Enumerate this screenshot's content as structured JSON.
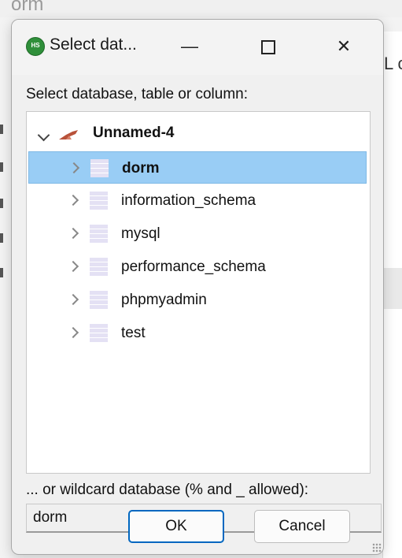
{
  "background": {
    "top_fragment": "orm",
    "right_fragment": "L c"
  },
  "dialog": {
    "app_icon_text": "HS",
    "title": "Select dat...",
    "controls": [
      "minimize-icon",
      "maximize-icon",
      "close-icon"
    ],
    "prompt": "Select database, table or column:",
    "tree": {
      "root": {
        "label": "Unnamed-4",
        "icon": "dolphin-connection-icon",
        "expanded": true
      },
      "items": [
        {
          "label": "dorm",
          "selected": true
        },
        {
          "label": "information_schema",
          "selected": false
        },
        {
          "label": "mysql",
          "selected": false
        },
        {
          "label": "performance_schema",
          "selected": false
        },
        {
          "label": "phpmyadmin",
          "selected": false
        },
        {
          "label": "test",
          "selected": false
        }
      ]
    },
    "wildcard_label": "... or wildcard database (% and _ allowed):",
    "wildcard_value": "dorm",
    "ok_label": "OK",
    "cancel_label": "Cancel"
  },
  "colors": {
    "selection": "#99cdf5",
    "default_button_border": "#0067c0",
    "app_icon": "#2f8f3a"
  }
}
